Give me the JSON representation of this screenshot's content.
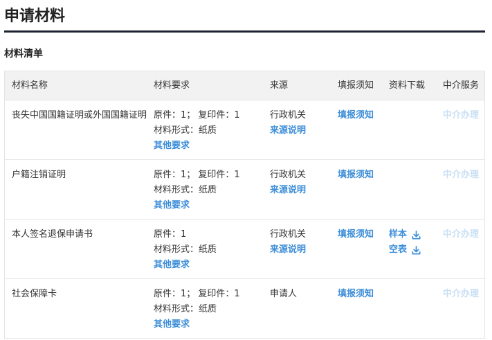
{
  "page": {
    "title": "申请材料",
    "section_title": "材料清单"
  },
  "table": {
    "headers": {
      "name": "材料名称",
      "requirement": "材料要求",
      "source": "来源",
      "fill_notice": "填报须知",
      "download": "资料下载",
      "agent": "中介服务"
    },
    "rows": [
      {
        "name": "丧失中国国籍证明或外国国籍证明",
        "req_count": "原件：1； 复印件：1",
        "req_form": "材料形式：纸质",
        "req_other": "其他要求",
        "source": "行政机关",
        "source_note": "来源说明",
        "fill_notice": "填报须知",
        "agent": "中介办理"
      },
      {
        "name": "户籍注销证明",
        "req_count": "原件：1； 复印件：1",
        "req_form": "材料形式：纸质",
        "req_other": "其他要求",
        "source": "行政机关",
        "source_note": "来源说明",
        "fill_notice": "填报须知",
        "agent": "中介办理"
      },
      {
        "name": "本人签名退保申请书",
        "req_count": "原件：1",
        "req_form": "材料形式：纸质",
        "req_other": "其他要求",
        "source": "行政机关",
        "source_note": "来源说明",
        "fill_notice": "填报须知",
        "download_sample": "样本",
        "download_blank": "空表",
        "download_icon": "download-icon",
        "agent": "中介办理"
      },
      {
        "name": "社会保障卡",
        "req_count": "原件：1； 复印件：1",
        "req_form": "材料形式：纸质",
        "req_other": "其他要求",
        "source": "申请人",
        "fill_notice": "填报须知",
        "agent": "中介办理"
      }
    ]
  },
  "colors": {
    "link": "#3c8dd8",
    "disabled_link": "#c9e0f4",
    "header_bg": "#f2f2f2",
    "title_rule": "#1c2230"
  }
}
